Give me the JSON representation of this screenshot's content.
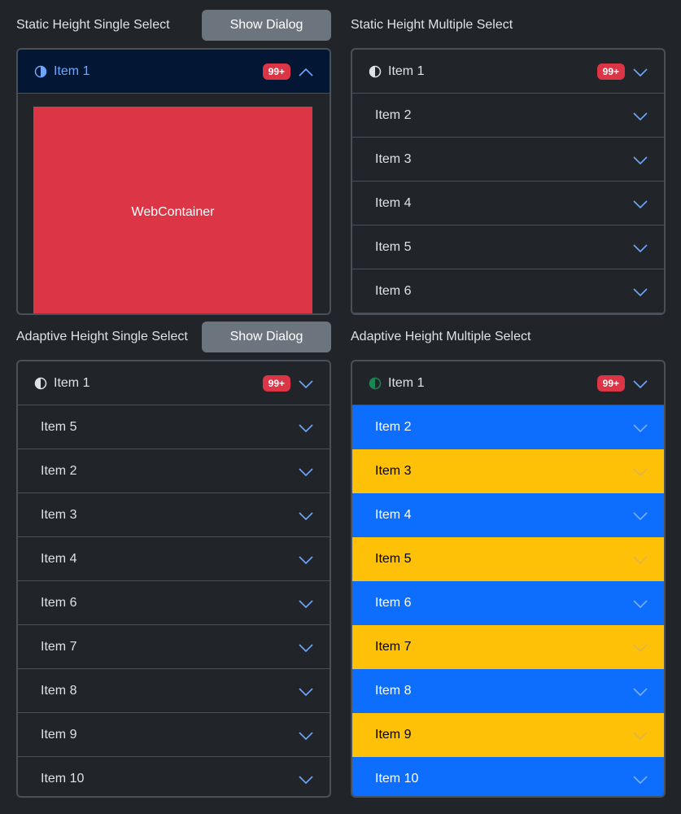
{
  "panels": {
    "static_single": {
      "title": "Static Height Single Select",
      "dialog_label": "Show Dialog",
      "web_container_label": "WebContainer"
    },
    "static_multiple": {
      "title": "Static Height Multiple Select"
    },
    "adaptive_single": {
      "title": "Adaptive Height Single Select",
      "dialog_label": "Show Dialog"
    },
    "adaptive_multiple": {
      "title": "Adaptive Height Multiple Select"
    }
  },
  "badge": "99+",
  "items": {
    "static_single": [
      "Item 1"
    ],
    "static_multiple": [
      "Item 1",
      "Item 2",
      "Item 3",
      "Item 4",
      "Item 5",
      "Item 6"
    ],
    "adaptive_single": [
      "Item 1",
      "Item 5",
      "Item 2",
      "Item 3",
      "Item 4",
      "Item 6",
      "Item 7",
      "Item 8",
      "Item 9",
      "Item 10"
    ],
    "adaptive_multiple": [
      "Item 1",
      "Item 2",
      "Item 3",
      "Item 4",
      "Item 5",
      "Item 6",
      "Item 7",
      "Item 8",
      "Item 9",
      "Item 10"
    ]
  },
  "colors": {
    "background": "#212529",
    "accent_blue": "#0d6efd",
    "accent_yellow": "#ffc107",
    "badge_red": "#dc3545",
    "active_header": "#031633",
    "icon_green": "#198754"
  },
  "icons": {
    "header_icon": "half-circle-icon",
    "expand_icon": "chevron-down-icon",
    "collapse_icon": "chevron-up-icon"
  }
}
